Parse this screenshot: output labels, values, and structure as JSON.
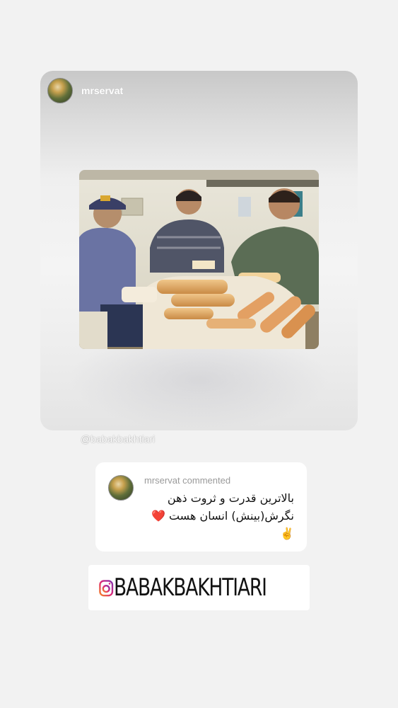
{
  "post": {
    "username": "mrservat"
  },
  "mention": {
    "text": "@babakbakhtiari"
  },
  "comment": {
    "meta": "mrservat commented",
    "body": "بالاترین قدرت و ثروت ذهن\nنگرش(بینش) انسان هست ❤️\n✌️"
  },
  "sticker": {
    "text": "BABAKBAKHTIARI"
  },
  "colors": {
    "background": "#f2f2f2",
    "card": "#ffffff",
    "heart": "#e0245e",
    "ig_gradient": [
      "#f58529",
      "#dd2a7b",
      "#8134af"
    ]
  },
  "icons": [
    "avatar",
    "instagram-icon"
  ]
}
